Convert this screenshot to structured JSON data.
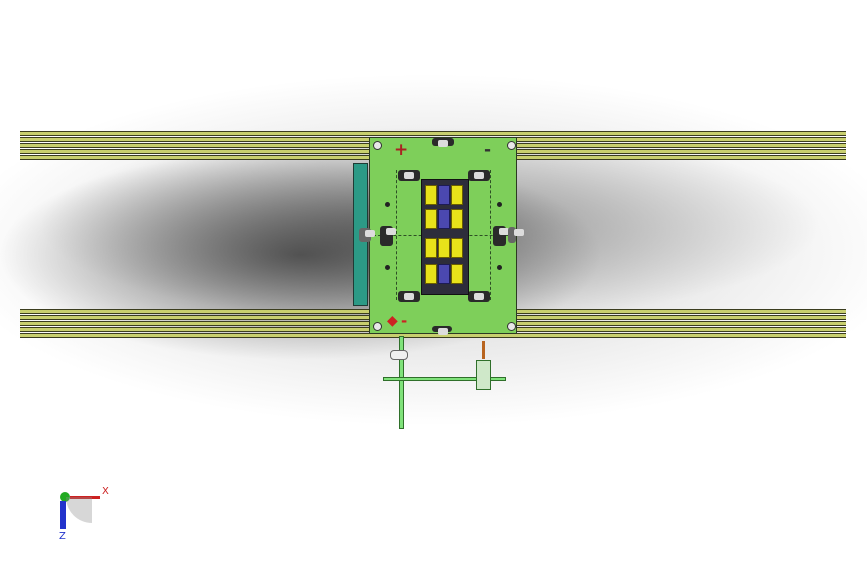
{
  "window": {
    "title": ""
  },
  "board": {
    "plus_symbol": "+",
    "minus_symbol": "-",
    "left_arrow_symbol": "◆"
  },
  "triad": {
    "x_label": "X",
    "z_label": "Z"
  },
  "colors": {
    "rail": "#c8cf6e",
    "board": "#7ecf5a",
    "battery_yellow": "#e8e21a",
    "battery_blue": "#4b48b0",
    "x_axis": "#cc2222",
    "y_axis": "#22aa22",
    "z_axis": "#2233cc",
    "polarity_plus": "#aa2222",
    "polarity_minus": "#333333"
  },
  "icons": {
    "triad": "coordinate-triad-icon",
    "plus": "plus-terminal-icon",
    "minus": "minus-terminal-icon"
  }
}
